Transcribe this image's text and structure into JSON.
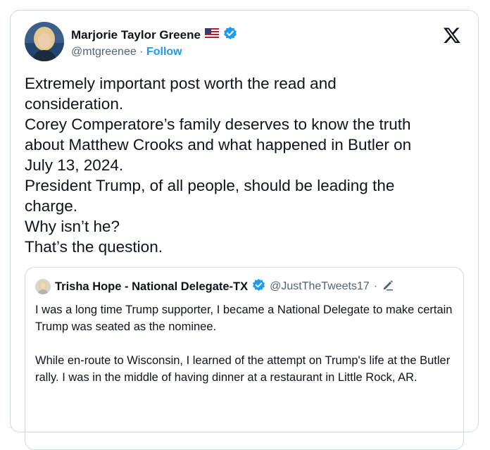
{
  "author": {
    "name": "Marjorie Taylor Greene",
    "flag_icon": "us-flag-icon",
    "verified_icon": "verified-badge-icon",
    "handle": "@mtgreenee",
    "separator": "·",
    "follow_label": "Follow"
  },
  "platform_icon": "x-logo-icon",
  "tweet": {
    "lines": [
      "Extremely important post worth the read and",
      "consideration.",
      "Corey Comperatore’s family deserves to know the truth",
      "about Matthew Crooks and what happened in Butler on",
      "July 13, 2024.",
      "President Trump, of all people, should be leading the",
      "charge.",
      "Why isn’t he?",
      "That’s the question."
    ]
  },
  "quoted": {
    "name": "Trisha Hope - National Delegate-TX",
    "handle": "@JustTheTweets17",
    "separator": "·",
    "edited_icon": "pencil-icon",
    "paragraphs": [
      "I was a long time Trump supporter, I became a National Delegate to make certain Trump was seated as the nominee.",
      "While en-route to Wisconsin, I learned of the attempt on Trump's life at the Butler rally.  I was in the middle of having dinner at a restaurant in Little Rock, AR."
    ]
  },
  "colors": {
    "accent": "#1d9bf0",
    "text": "#0f1419",
    "secondary_text": "#536471",
    "border": "#cfd9de"
  }
}
